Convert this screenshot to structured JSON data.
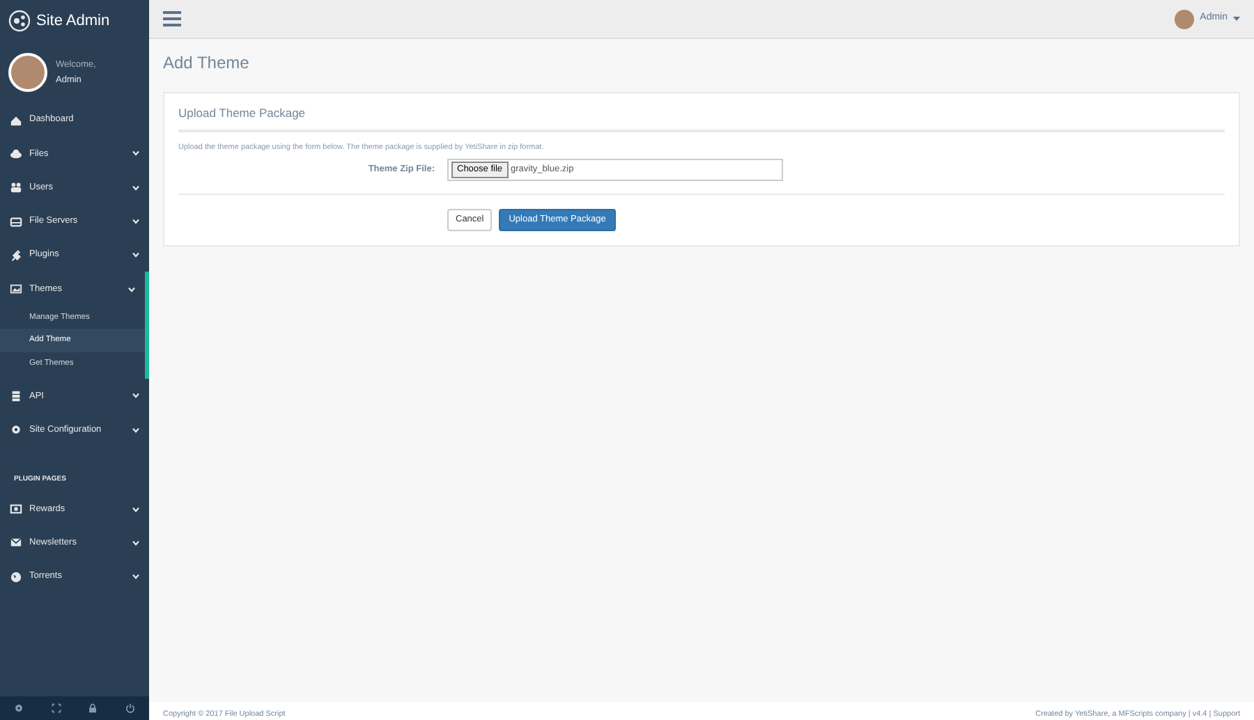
{
  "brand": {
    "title": "Site Admin"
  },
  "profile": {
    "greeting": "Welcome,",
    "name": "Admin"
  },
  "nav": [
    {
      "label": "Dashboard",
      "chevron": false
    },
    {
      "label": "Files",
      "chevron": true
    },
    {
      "label": "Users",
      "chevron": true
    },
    {
      "label": "File Servers",
      "chevron": true
    },
    {
      "label": "Plugins",
      "chevron": true
    },
    {
      "label": "Themes",
      "chevron": true,
      "expanded": true,
      "children": [
        {
          "label": "Manage Themes",
          "selected": false
        },
        {
          "label": "Add Theme",
          "selected": true
        },
        {
          "label": "Get Themes",
          "selected": false
        }
      ]
    },
    {
      "label": "API",
      "chevron": true
    },
    {
      "label": "Site Configuration",
      "chevron": true
    }
  ],
  "plugin_section": {
    "heading": "PLUGIN PAGES",
    "items": [
      {
        "label": "Rewards"
      },
      {
        "label": "Newsletters"
      },
      {
        "label": "Torrents"
      }
    ]
  },
  "topbar": {
    "user": "Admin"
  },
  "page": {
    "title": "Add Theme",
    "panel_title": "Upload Theme Package",
    "description": "Upload the theme package using the form below. The theme package is supplied by YetiShare in zip format.",
    "field_label": "Theme Zip File:",
    "file_button": "Choose file",
    "file_name": "gravity_blue.zip",
    "cancel": "Cancel",
    "submit": "Upload Theme Package"
  },
  "footer": {
    "left": "Copyright © 2017 File Upload Script",
    "right": "Created by YetiShare, a MFScripts company | v4.4 | Support"
  }
}
